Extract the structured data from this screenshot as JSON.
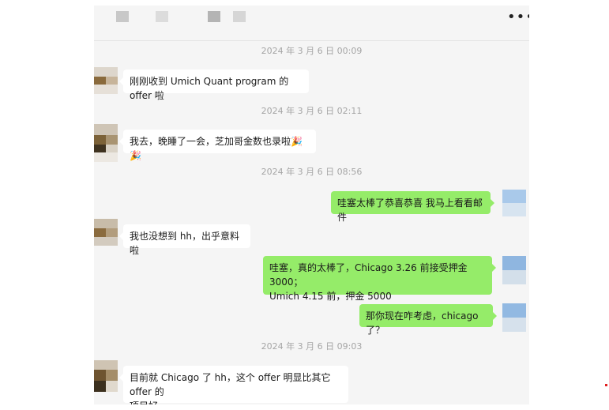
{
  "header": {
    "more_icon": "more-horizontal-icon",
    "more_glyph": "•••"
  },
  "colors": {
    "sent_bubble": "#95ec69",
    "received_bubble": "#ffffff",
    "chat_bg": "#f5f5f5",
    "timestamp": "#a5a5a5"
  },
  "messages": {
    "ts1": "2024 年 3 月 6 日 00:09",
    "m1": "刚刚收到 Umich Quant program 的 offer 啦",
    "ts2": "2024 年 3 月 6 日 02:11",
    "m2": "我去，晚睡了一会，芝加哥金数也录啦🎉🎉",
    "ts3": "2024 年 3 月 6 日 08:56",
    "m3": "哇塞太棒了恭喜恭喜 我马上看看邮件",
    "m4": "我也没想到 hh，出乎意料啦",
    "m5": "哇塞，真的太棒了，Chicago 3.26 前接受押金 3000；\nUmich 4.15 前，押金 5000",
    "m6": "那你现在咋考虑，chicago 了？",
    "ts4": "2024 年 3 月 6 日 09:03",
    "m7": "目前就 Chicago 了 hh，这个 offer 明显比其它 offer 的\n项目好"
  }
}
